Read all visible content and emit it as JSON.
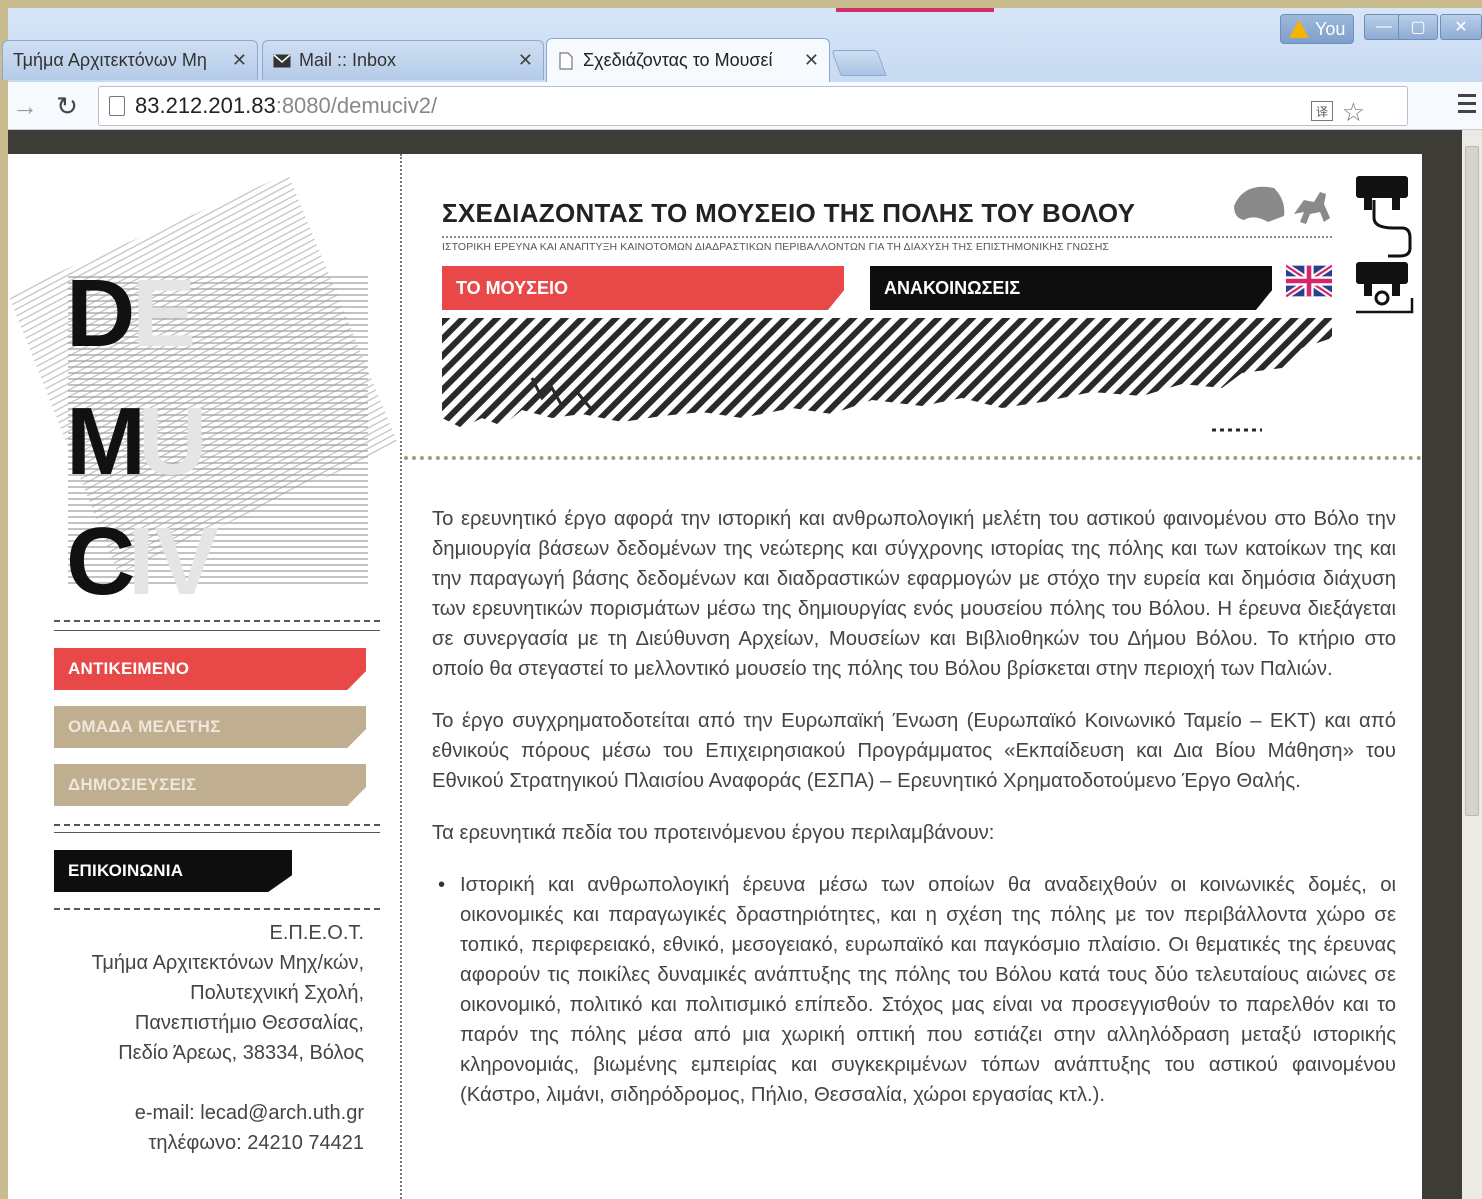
{
  "browser": {
    "tabs": [
      {
        "title": "Τμήμα Αρχιτεκτόνων Μη",
        "icon": "document-icon"
      },
      {
        "title": "Mail :: Inbox",
        "icon": "mail-icon"
      },
      {
        "title": "Σχεδιάζοντας το Μουσεί",
        "icon": "page-icon"
      }
    ],
    "profile_label": "You",
    "url_host": "83.212.201.83",
    "url_rest": ":8080/demuciv2/",
    "accent_colors": {
      "tab_pink": "#d0306a"
    }
  },
  "logo": {
    "letters_dark": [
      "D",
      "M",
      "C"
    ],
    "letters_light": [
      "E",
      "U",
      "IV"
    ]
  },
  "sidebar": {
    "items": [
      {
        "label": "ΑΝΤΙΚΕΙΜΕΝΟ",
        "color": "#e84848"
      },
      {
        "label": "ΟΜΑΔΑ ΜΕΛΕΤΗΣ",
        "color": "#bfae90"
      },
      {
        "label": "ΔΗΜΟΣΙΕΥΣΕΙΣ",
        "color": "#bfae90"
      }
    ],
    "contact_button": "ΕΠΙΚΟΙΝΩΝΙΑ",
    "contact": {
      "line1": "Ε.Π.Ε.Ο.Τ.",
      "line2": "Τμήμα Αρχιτεκτόνων Μηχ/κών,",
      "line3": "Πολυτεχνική Σχολή,",
      "line4": "Πανεπιστήμιο Θεσσαλίας,",
      "line5": "Πεδίο Άρεως, 38334, Βόλος",
      "email": "e-mail: lecad@arch.uth.gr",
      "phone": "τηλέφωνο: 24210 74421"
    }
  },
  "header": {
    "title": "ΣΧΕΔΙΑΖΟΝΤΑΣ ΤΟ ΜΟΥΣΕΙΟ ΤΗΣ ΠΟΛΗΣ ΤΟΥ ΒΟΛΟΥ",
    "subtitle": "ΙΣΤΟΡΙΚΗ ΕΡΕΥΝΑ ΚΑΙ ΑΝΑΠΤΥΞΗ ΚΑΙΝΟΤΟΜΩΝ ΔΙΑΔΡΑΣΤΙΚΩΝ ΠΕΡΙΒΑΛΛΟΝΤΩΝ ΓΙΑ ΤΗ ΔΙΑΧΥΣΗ ΤΗΣ ΕΠΙΣΤΗΜΟΝΙΚΗΣ ΓΝΩΣΗΣ",
    "nav_museum": "ΤΟ ΜΟΥΣΕΙΟ",
    "nav_announcements": "ΑΝΑΚΟΙΝΩΣΕΙΣ"
  },
  "content": {
    "p1": "Το ερευνητικό έργο αφορά την ιστορική και ανθρωπολογική μελέτη του αστικού φαινομένου στο Βόλο την δημιουργία βάσεων δεδομένων της νεώτερης και σύγχρονης ιστορίας της πόλης και των κατοίκων της και την παραγωγή βάσης δεδομένων και διαδραστικών εφαρμογών με στόχο την ευρεία και δημόσια διάχυση των ερευνητικών πορισμάτων μέσω της δημιουργίας ενός μουσείου πόλης του Βόλου. Η έρευνα διεξάγεται σε συνεργασία με τη Διεύθυνση Αρχείων, Μουσείων και Βιβλιοθηκών του Δήμου Βόλου. Το κτήριο στο οποίο θα στεγαστεί το μελλοντικό μουσείο της πόλης του Βόλου βρίσκεται στην περιοχή των Παλιών.",
    "p2": "Το έργο συγχρηματοδοτείται από την Ευρωπαϊκή Ένωση (Ευρωπαϊκό Κοινωνικό Ταμείο – ΕΚΤ) και από εθνικούς πόρους μέσω του Επιχειρησιακού Προγράμματος «Εκπαίδευση και Δια Βίου Μάθηση» του Εθνικού Στρατηγικού Πλαισίου Αναφοράς (ΕΣΠΑ) – Ερευνητικό Χρηματοδοτούμενο Έργο Θαλής.",
    "p3": "Τα ερευνητικά πεδία του προτεινόμενου έργου περιλαμβάνουν:",
    "bullet1": "Ιστορική και ανθρωπολογική έρευνα μέσω των οποίων θα αναδειχθούν οι κοινωνικές δομές, οι οικονομικές και παραγωγικές δραστηριότητες, και η σχέση της πόλης με τον περιβάλλοντα χώρο σε τοπικό, περιφερειακό, εθνικό, μεσογειακό, ευρωπαϊκό και παγκόσμιο πλαίσιο. Οι θεματικές της έρευνας αφορούν τις ποικίλες δυναμικές ανάπτυξης της πόλης του Βόλου κατά τους δύο τελευταίους αιώνες σε οικονομικό, πολιτικό και πολιτισμικό επίπεδο. Στόχος μας είναι να προσεγγισθούν το παρελθόν και το παρόν της πόλης μέσα από μια χωρική οπτική που εστιάζει στην αλληλόδραση μεταξύ ιστορικής κληρονομιάς, βιωμένης εμπειρίας και συγκεκριμένων τόπων ανάπτυξης του αστικού φαινομένου (Κάστρο, λιμάνι, σιδηρόδρομος, Πήλιο, Θεσσαλία, χώροι εργασίας κτλ.)."
  }
}
